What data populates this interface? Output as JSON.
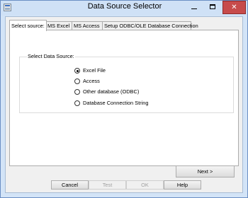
{
  "window": {
    "title": "Data Source Selector",
    "controls": {
      "minimize": "–",
      "maximize": "□",
      "close": "✕"
    }
  },
  "tabs": [
    {
      "label": "Select source:",
      "active": true
    },
    {
      "label": "MS Excel",
      "active": false
    },
    {
      "label": "MS Access",
      "active": false
    },
    {
      "label": "Setup ODBC/OLE Database Connection",
      "active": false
    }
  ],
  "select_panel": {
    "group_label": "Select Data Source:",
    "options": [
      {
        "label": "Excel File",
        "checked": true
      },
      {
        "label": "Access",
        "checked": false
      },
      {
        "label": "Other database (ODBC)",
        "checked": false
      },
      {
        "label": "Database Connection String",
        "checked": false
      }
    ],
    "next_label": "Next >"
  },
  "footer": {
    "cancel_label": "Cancel",
    "test_label": "Test",
    "ok_label": "OK",
    "help_label": "Help"
  }
}
